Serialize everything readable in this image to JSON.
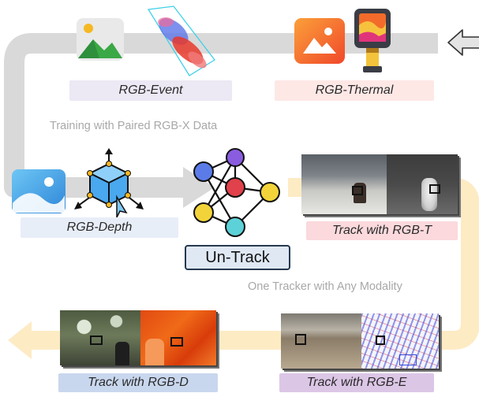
{
  "training": {
    "caption": "Training with Paired RGB-X Data",
    "rgb_event_label": "RGB-Event",
    "rgb_thermal_label": "RGB-Thermal",
    "rgb_depth_label": "RGB-Depth"
  },
  "model": {
    "name": "Un-Track"
  },
  "inference": {
    "caption": "One Tracker with Any Modality",
    "track_rgbt_label": "Track with RGB-T",
    "track_rgbe_label": "Track with RGB-E",
    "track_rgbd_label": "Track with RGB-D"
  },
  "colors": {
    "flow_gray": "#d9d9d9",
    "flow_yellow": "#fde9bd",
    "event_pill": "#ece8f4",
    "thermal_pill": "#fde8e6",
    "depth_pill": "#e8eef8",
    "rgbt_pill": "#fbd9dc",
    "rgbe_pill": "#dcc6e6",
    "rgbd_pill": "#c9d7ee",
    "model_border": "#26394f",
    "model_fill": "#dfe8f3"
  },
  "icons": [
    "landscape-photo-icon",
    "event-point-cloud-icon",
    "thermal-camera-icon",
    "depth-cube-icon",
    "neural-network-icon",
    "back-arrow-icon"
  ]
}
